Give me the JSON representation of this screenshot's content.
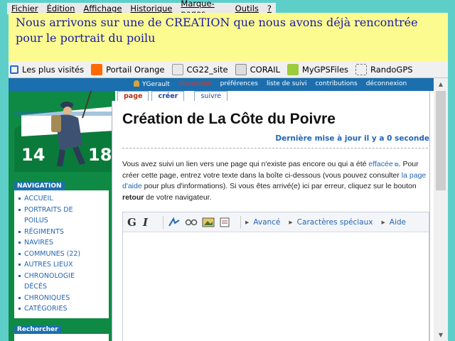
{
  "menu": [
    "Fichier",
    "Édition",
    "Affichage",
    "Historique",
    "Marque-pages",
    "Outils",
    "?"
  ],
  "note": "Nous arrivons sur une de CREATION que nous avons déjà rencontrée pour le portrait du poilu",
  "bookmarks": [
    {
      "label": "Les plus visités",
      "icon": "search-icon"
    },
    {
      "label": "Portail Orange",
      "icon": "orange-icon"
    },
    {
      "label": "CG22_site",
      "icon": "cg22-icon"
    },
    {
      "label": "CORAIL",
      "icon": "corail-icon"
    },
    {
      "label": "MyGPSFiles",
      "icon": "mygps-icon"
    },
    {
      "label": "RandoGPS",
      "icon": "page-icon"
    }
  ],
  "personal": {
    "user": "YGerault",
    "discussion": "discussion",
    "prefs": "préférences",
    "watchlist": "liste de suivi",
    "contribs": "contributions",
    "logout": "déconnexion"
  },
  "tabs": {
    "page": "page",
    "create": "créer",
    "watch": "suivre"
  },
  "logo": {
    "left": "14",
    "right": "18"
  },
  "article": {
    "title": "Création de La Côte du Poivre",
    "updated": "Dernière mise à jour il y a 0 seconde",
    "p1": "Vous avez suivi un lien vers une page qui n'existe pas encore ou qui a été ",
    "link_effacee": "effacée",
    "p2": ". Pour créer cette page, entrez votre texte dans la boîte ci-dessous (vous pouvez consulter ",
    "link_aide": "la page d'aide",
    "p3": " pour plus d'informations). Si vous êtes arrivé(e) ici par erreur, cliquez sur le bouton ",
    "retour": "retour",
    "p4": " de votre navigateur."
  },
  "toolbar": {
    "bold": "G",
    "italic": "I",
    "advanced": "Avancé",
    "special": "Caractères spéciaux",
    "help": "Aide"
  },
  "nav": {
    "header": "NAVIGATION",
    "items": [
      "ACCUEIL",
      "PORTRAITS DE",
      "POILUS",
      "RÉGIMENTS",
      "NAVIRES",
      "COMMUNES (22)",
      "AUTRES LIEUX",
      "CHRONOLOGIE",
      "DÉCÈS",
      "CHRONIQUES",
      "CATÉGORIES"
    ]
  },
  "search": {
    "header": "Rechercher"
  }
}
